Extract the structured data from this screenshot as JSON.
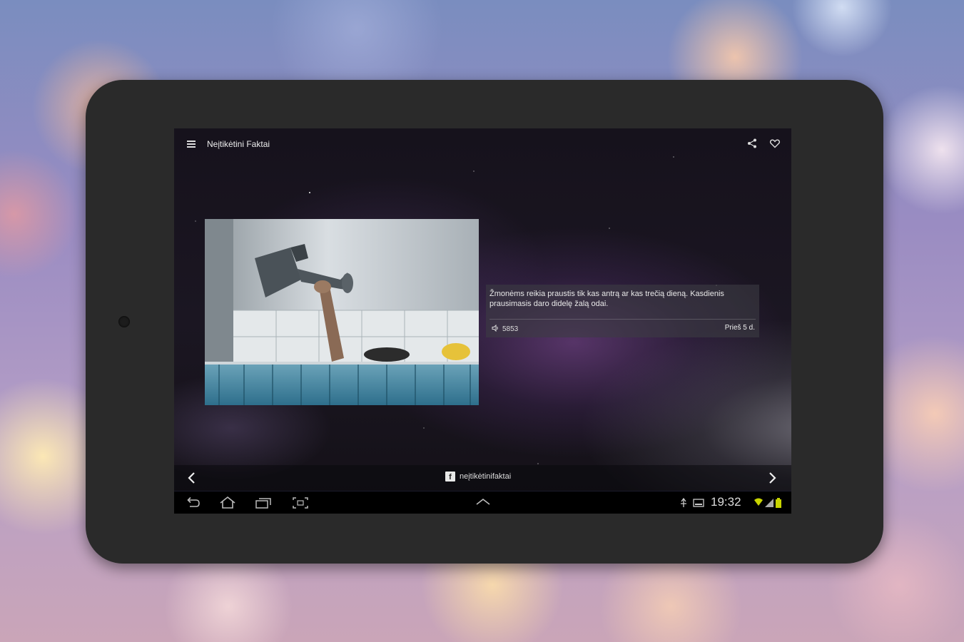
{
  "app": {
    "title": "Neįtikėtini Faktai"
  },
  "fact": {
    "text": "Žmonėms reikia praustis tik kas antrą ar kas trečią dieną. Kasdienis prausimasis daro didelę žalą odai.",
    "views": "5853",
    "time_ago": "Prieš 5 d."
  },
  "footer": {
    "facebook_label": "neįtikėtinifaktai"
  },
  "system": {
    "clock": "19:32"
  },
  "icons": {
    "menu": "menu-icon",
    "share": "share-icon",
    "favorite": "heart-icon",
    "views": "speaker-icon",
    "prev": "chevron-left-icon",
    "next": "chevron-right-icon",
    "facebook": "facebook-icon",
    "back": "back-icon",
    "home": "home-icon",
    "recents": "recent-apps-icon",
    "screenshot": "screenshot-icon",
    "up": "chevron-up-icon"
  },
  "colors": {
    "battery": "#c8d400",
    "bezel": "#2a2a2a"
  }
}
